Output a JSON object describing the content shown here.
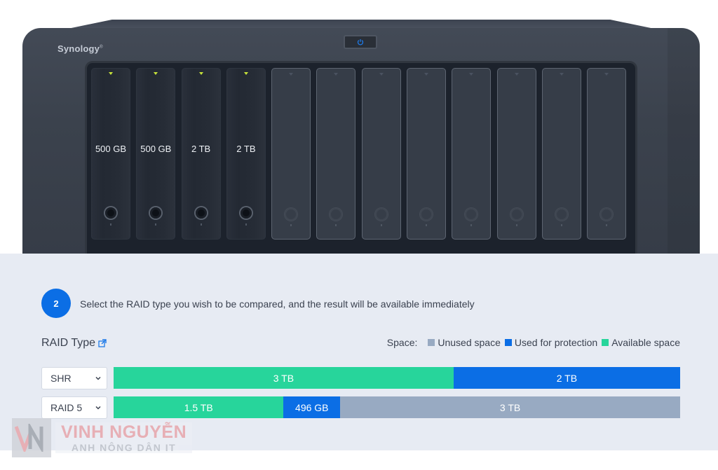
{
  "device": {
    "brand": "Synology",
    "brand_mark": "®",
    "power_icon": "power-icon",
    "drives": [
      {
        "capacity": "500 GB",
        "installed": true
      },
      {
        "capacity": "500 GB",
        "installed": true
      },
      {
        "capacity": "2 TB",
        "installed": true
      },
      {
        "capacity": "2 TB",
        "installed": true
      },
      {
        "capacity": "",
        "installed": false
      },
      {
        "capacity": "",
        "installed": false
      },
      {
        "capacity": "",
        "installed": false
      },
      {
        "capacity": "",
        "installed": false
      },
      {
        "capacity": "",
        "installed": false
      },
      {
        "capacity": "",
        "installed": false
      },
      {
        "capacity": "",
        "installed": false
      },
      {
        "capacity": "",
        "installed": false
      }
    ]
  },
  "step": {
    "number": "2",
    "instruction": "Select the RAID type you wish to be compared, and the result will be available immediately"
  },
  "raid": {
    "label": "RAID Type",
    "link_icon": "external-link-icon"
  },
  "legend": {
    "label": "Space:",
    "items": [
      {
        "name": "Unused space",
        "color": "#98aac2"
      },
      {
        "name": "Used for protection",
        "color": "#0b6ee5"
      },
      {
        "name": "Available space",
        "color": "#27d59b"
      }
    ]
  },
  "colors": {
    "available": "#27d59b",
    "protection": "#0b6ee5",
    "unused": "#98aac2",
    "accent": "#0b6ee5"
  },
  "rows": [
    {
      "raid_type": "SHR",
      "segments": [
        {
          "type": "available",
          "label": "3 TB",
          "fraction": 0.6
        },
        {
          "type": "protection",
          "label": "2 TB",
          "fraction": 0.4
        }
      ]
    },
    {
      "raid_type": "RAID 5",
      "segments": [
        {
          "type": "available",
          "label": "1.5 TB",
          "fraction": 0.3
        },
        {
          "type": "protection",
          "label": "496 GB",
          "fraction": 0.1
        },
        {
          "type": "unused",
          "label": "3 TB",
          "fraction": 0.6
        }
      ]
    }
  ],
  "watermark": {
    "name": "VINH NGUYỄN",
    "subtitle": "ANH NÔNG DÂN IT"
  }
}
